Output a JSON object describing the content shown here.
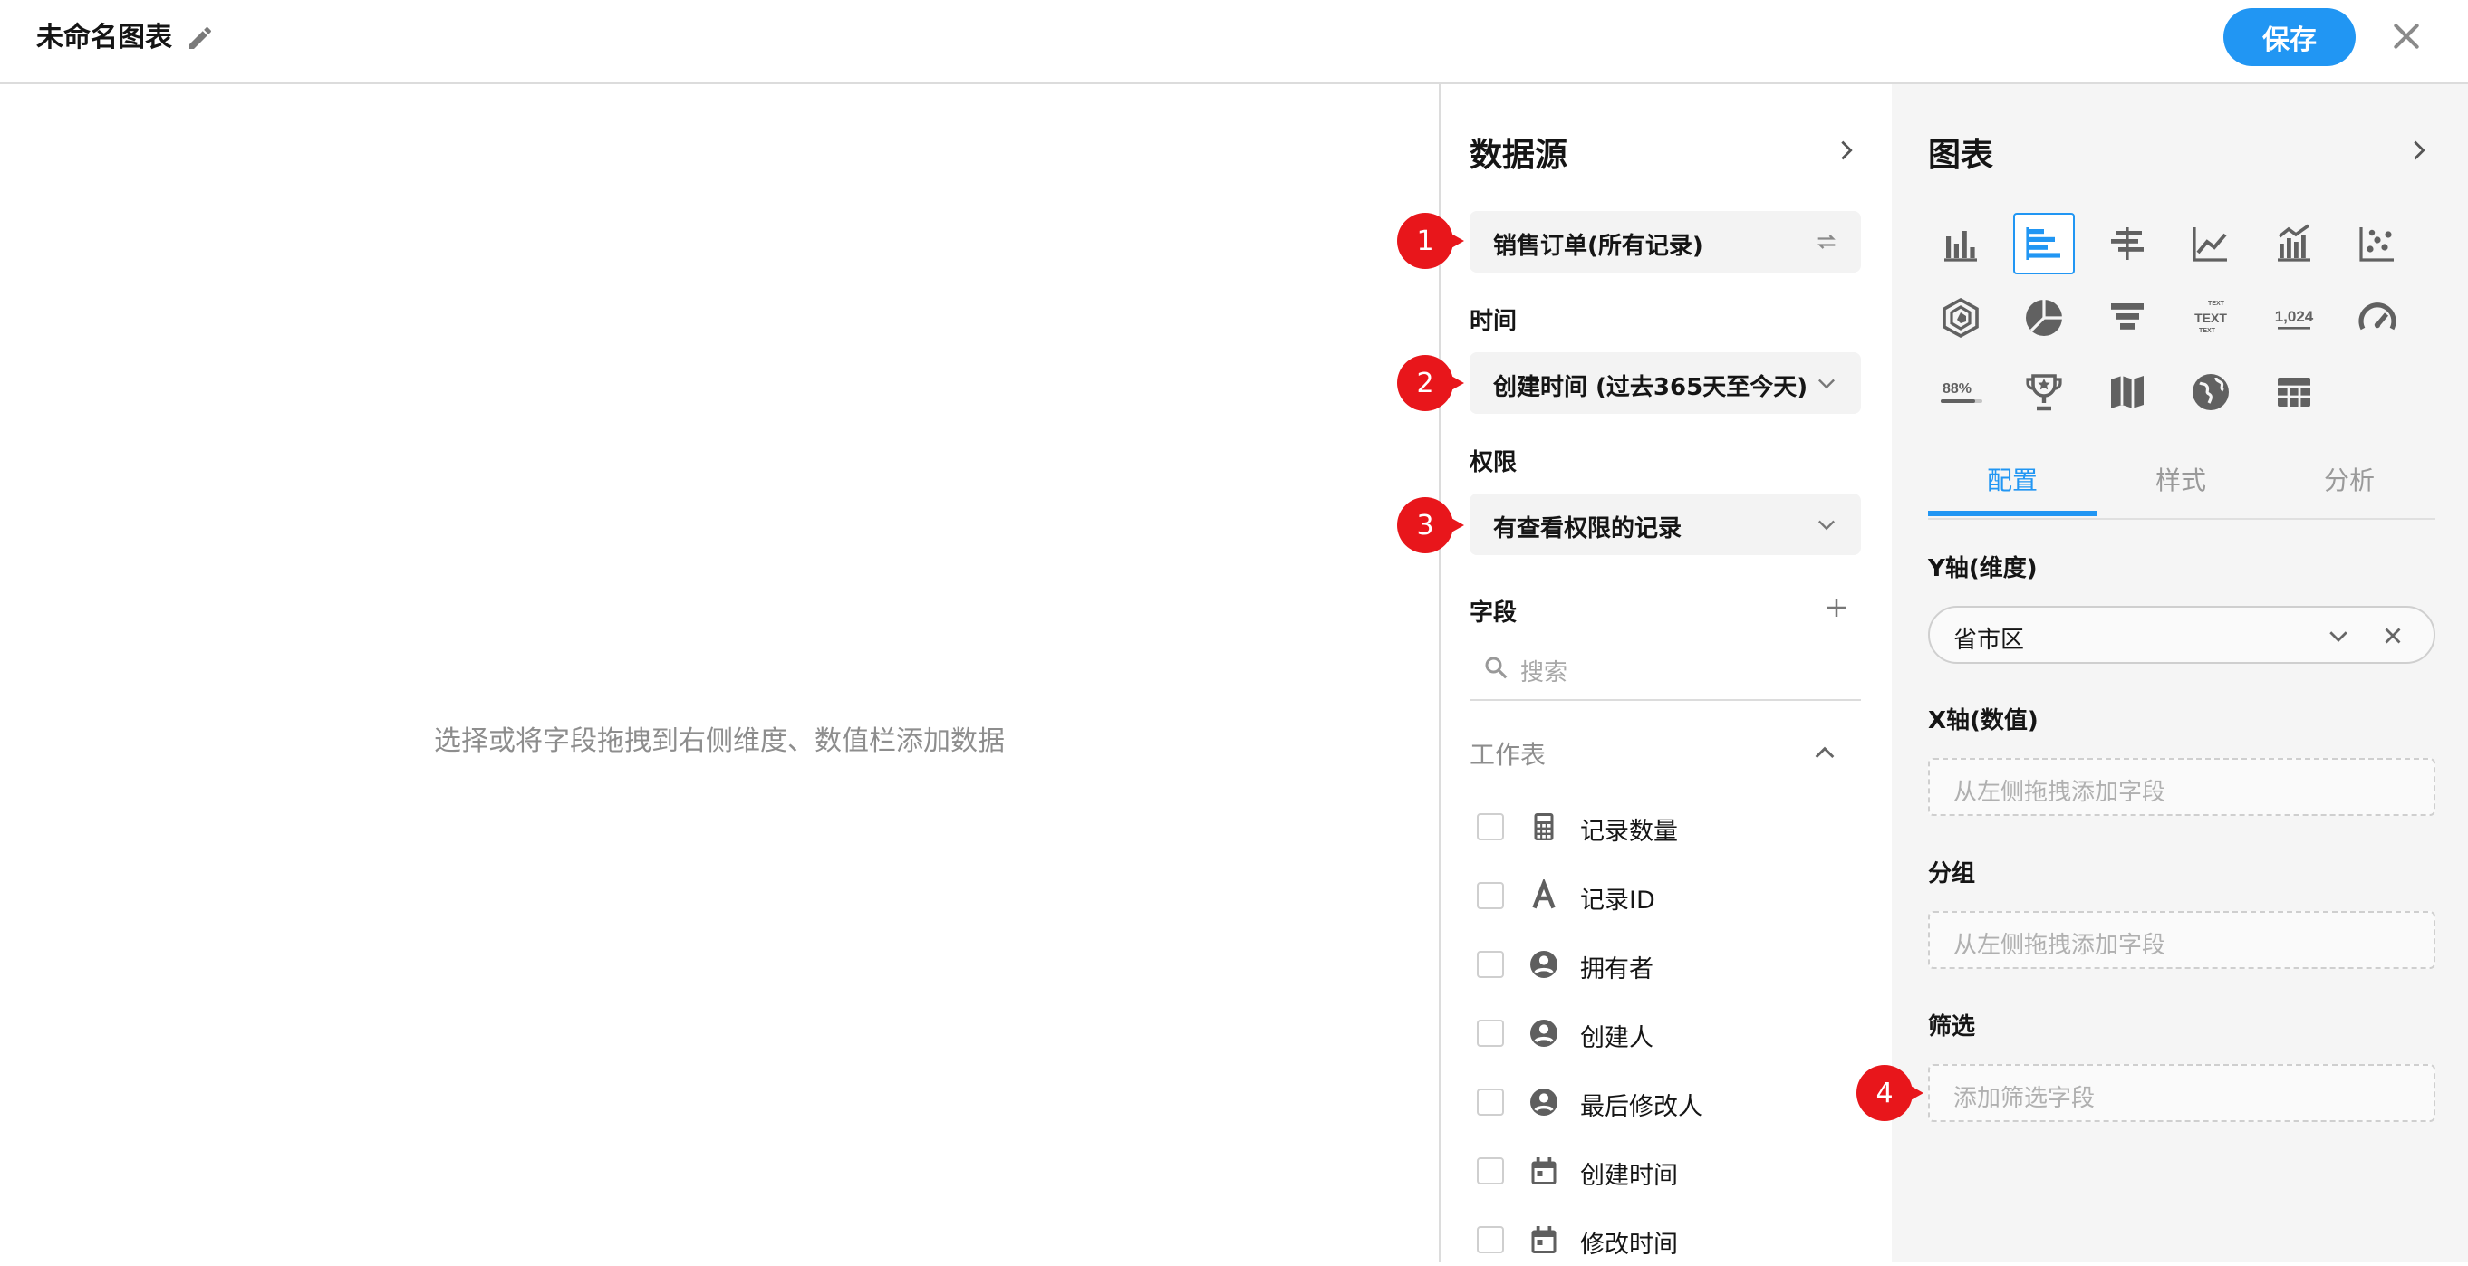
{
  "header": {
    "title": "未命名图表",
    "save_label": "保存"
  },
  "canvas": {
    "placeholder": "选择或将字段拖拽到右侧维度、数值栏添加数据"
  },
  "datasource": {
    "title": "数据源",
    "source_value": "销售订单(所有记录)",
    "time_label": "时间",
    "time_value": "创建时间 (过去365天至今天)",
    "permission_label": "权限",
    "permission_value": "有查看权限的记录",
    "fields_label": "字段",
    "search_placeholder": "搜索",
    "group_label": "工作表",
    "fields": [
      {
        "name": "记录数量",
        "icon": "calculator-icon"
      },
      {
        "name": "记录ID",
        "icon": "text-icon"
      },
      {
        "name": "拥有者",
        "icon": "person-icon"
      },
      {
        "name": "创建人",
        "icon": "person-icon"
      },
      {
        "name": "最后修改人",
        "icon": "person-icon"
      },
      {
        "name": "创建时间",
        "icon": "calendar-icon"
      },
      {
        "name": "修改时间",
        "icon": "calendar-icon"
      }
    ]
  },
  "badges": [
    "1",
    "2",
    "3",
    "4"
  ],
  "chart_panel": {
    "title": "图表",
    "chart_types": [
      "bar-chart-icon",
      "horizontal-bar-chart-icon",
      "dual-axis-bar-icon",
      "line-chart-icon",
      "combo-chart-icon",
      "scatter-chart-icon",
      "radar-chart-icon",
      "pie-chart-icon",
      "funnel-chart-icon",
      "word-cloud-icon",
      "number-chart-icon",
      "gauge-chart-icon",
      "progress-chart-icon",
      "ranking-chart-icon",
      "map-chart-icon",
      "world-map-icon",
      "table-chart-icon"
    ],
    "selected_chart_type": "horizontal-bar-chart-icon",
    "tabs": [
      {
        "label": "配置"
      },
      {
        "label": "样式"
      },
      {
        "label": "分析"
      }
    ],
    "active_tab": "配置",
    "y_axis_label": "Y轴(维度)",
    "y_axis_value": "省市区",
    "x_axis_label": "X轴(数值)",
    "x_axis_placeholder": "从左侧拖拽添加字段",
    "group_label": "分组",
    "group_placeholder": "从左侧拖拽添加字段",
    "filter_label": "筛选",
    "filter_placeholder": "添加筛选字段",
    "number_icon_text": "1,024",
    "progress_icon_text": "88%",
    "wordcloud_icon_text": "TEXT"
  },
  "colors": {
    "accent": "#2196f3",
    "badge": "#e8161b"
  }
}
